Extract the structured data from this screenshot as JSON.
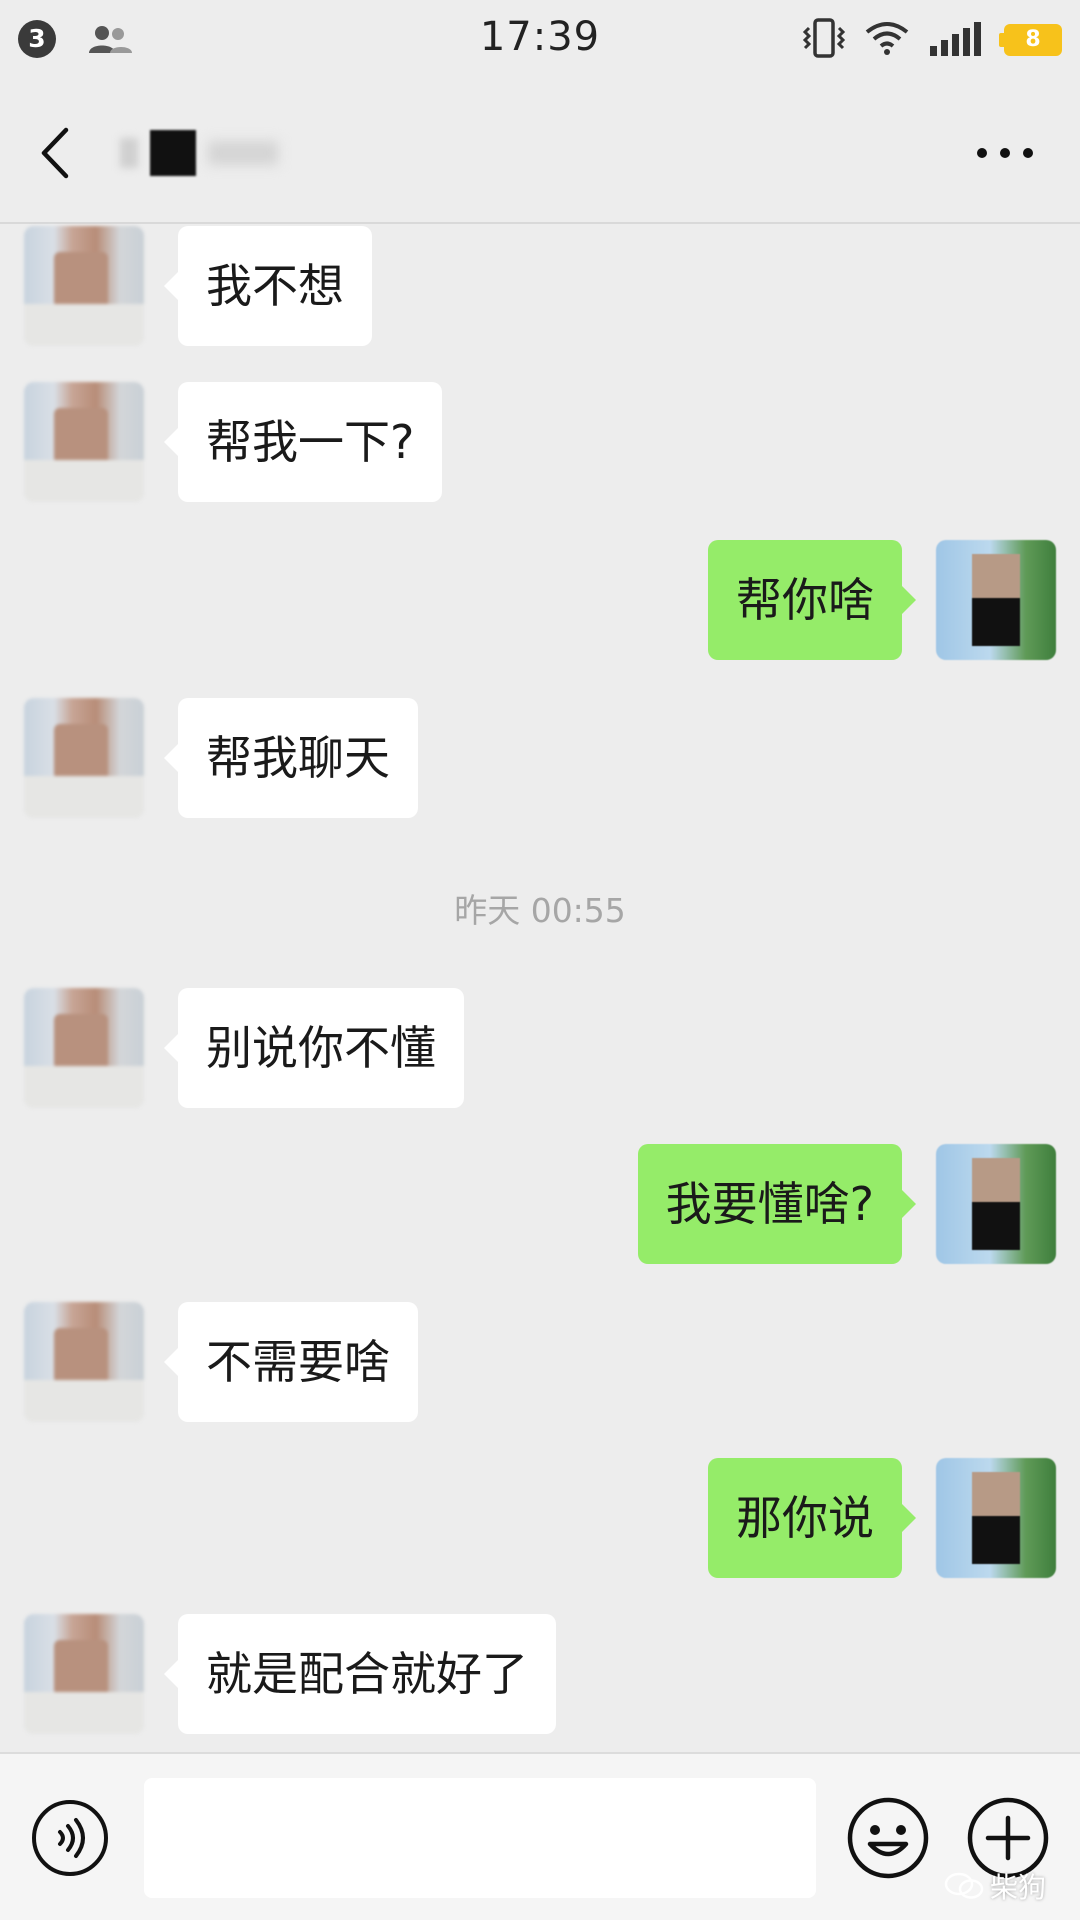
{
  "status_bar": {
    "notification_count": "3",
    "time": "17:39",
    "battery": "8",
    "battery_color": "#f7c21b"
  },
  "nav": {
    "back_icon": "chevron-left-icon",
    "more_icon": "more-horizontal-icon"
  },
  "colors": {
    "background": "#ededed",
    "sent_bubble": "#95ec69",
    "received_bubble": "#ffffff",
    "timestamp_text": "#a6a6a6"
  },
  "messages": [
    {
      "side": "left",
      "text": "我不想"
    },
    {
      "side": "left",
      "text": "帮我一下?"
    },
    {
      "side": "right",
      "text": "帮你啥"
    },
    {
      "side": "left",
      "text": "帮我聊天"
    },
    {
      "side": "left",
      "text": "别说你不懂"
    },
    {
      "side": "right",
      "text": "我要懂啥?"
    },
    {
      "side": "left",
      "text": "不需要啥"
    },
    {
      "side": "right",
      "text": "那你说"
    },
    {
      "side": "left",
      "text": "就是配合就好了"
    }
  ],
  "timestamp": "昨天 00:55",
  "input_bar": {
    "voice_icon": "voice-icon",
    "emoji_icon": "emoji-icon",
    "plus_icon": "plus-icon",
    "input_value": ""
  },
  "watermark": "柴狗"
}
